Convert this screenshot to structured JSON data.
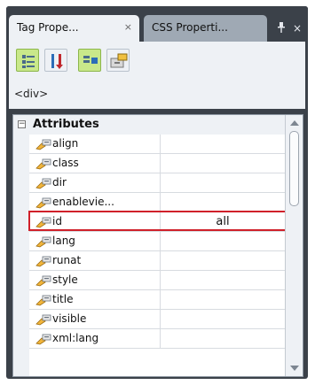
{
  "tabs": [
    {
      "label": "Tag Prope...",
      "close": "×"
    },
    {
      "label": "CSS Properti..."
    }
  ],
  "window_controls": {
    "pin": "■",
    "close": "×"
  },
  "toolbar": {
    "buttons": [
      {
        "icon": "categorized-view-icon",
        "active": true
      },
      {
        "icon": "alphabetical-sort-icon",
        "active": false
      },
      {
        "icon": "show-set-properties-icon",
        "active": true
      },
      {
        "icon": "properties-page-icon",
        "active": false
      }
    ]
  },
  "current_tag": "<div>",
  "grid": {
    "section": {
      "title": "Attributes",
      "toggle": "−"
    },
    "rows": [
      {
        "name": "align",
        "value": ""
      },
      {
        "name": "class",
        "value": ""
      },
      {
        "name": "dir",
        "value": ""
      },
      {
        "name": "enablevie...",
        "value": ""
      },
      {
        "name": "id",
        "value": "all"
      },
      {
        "name": "lang",
        "value": ""
      },
      {
        "name": "runat",
        "value": ""
      },
      {
        "name": "style",
        "value": ""
      },
      {
        "name": "title",
        "value": ""
      },
      {
        "name": "visible",
        "value": ""
      },
      {
        "name": "xml:lang",
        "value": ""
      }
    ],
    "selected_attribute": "id"
  },
  "colors": {
    "highlight": "#d0202a",
    "active_button": "#c9e88a",
    "panel_bg": "#eef1f5",
    "frame": "#3b4149"
  }
}
